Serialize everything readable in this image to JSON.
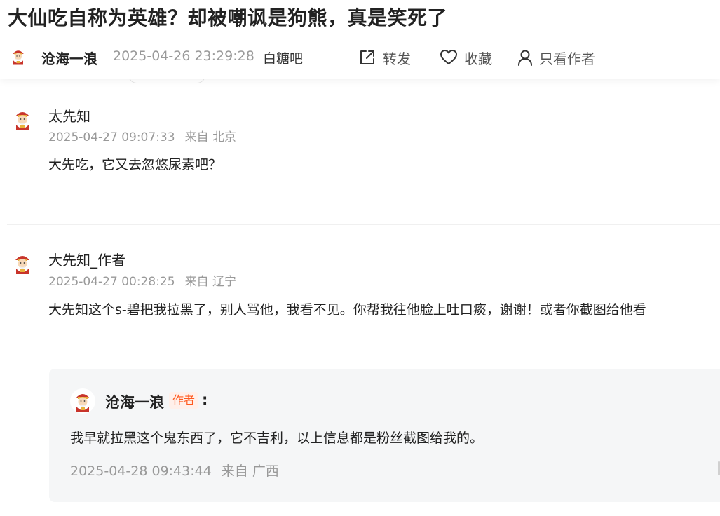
{
  "post": {
    "title": "大仙吃自称为英雄？却被嘲讽是狗熊，真是笑死了",
    "author": "沧海一浪",
    "time": "2025-04-26 23:29:28",
    "forum": "白糖吧",
    "actions": {
      "share_label": "转发",
      "favorite_label": "收藏",
      "only_author_label": "只看作者"
    }
  },
  "comments": [
    {
      "user": "太先知",
      "time": "2025-04-27 09:07:33",
      "location": "来自 北京",
      "text": "大先吃，它又去忽悠尿素吧？"
    },
    {
      "user": "大先知_作者",
      "time": "2025-04-27 00:28:25",
      "location": "来自 辽宁",
      "text": "大先知这个s-碧把我拉黑了，别人骂他，我看不见。你帮我往他脸上吐口痰，谢谢！或者你截图给他看",
      "reply": {
        "user": "沧海一浪",
        "badge": "作者",
        "colon": ":",
        "text": "我早就拉黑这个鬼东西了，它不吉利，以上信息都是粉丝截图给我的。",
        "time": "2025-04-28 09:43:44",
        "location": "来自 广西"
      }
    }
  ],
  "icons": {
    "avatar": "caishen-avatar-icon",
    "share": "share-external-icon",
    "favorite": "heart-icon",
    "only_author": "person-icon"
  },
  "colors": {
    "muted_text": "#999999",
    "author_badge_text": "#ff5a1f",
    "author_badge_bg": "#fff0ea",
    "reply_bg": "#f5f6f7"
  }
}
